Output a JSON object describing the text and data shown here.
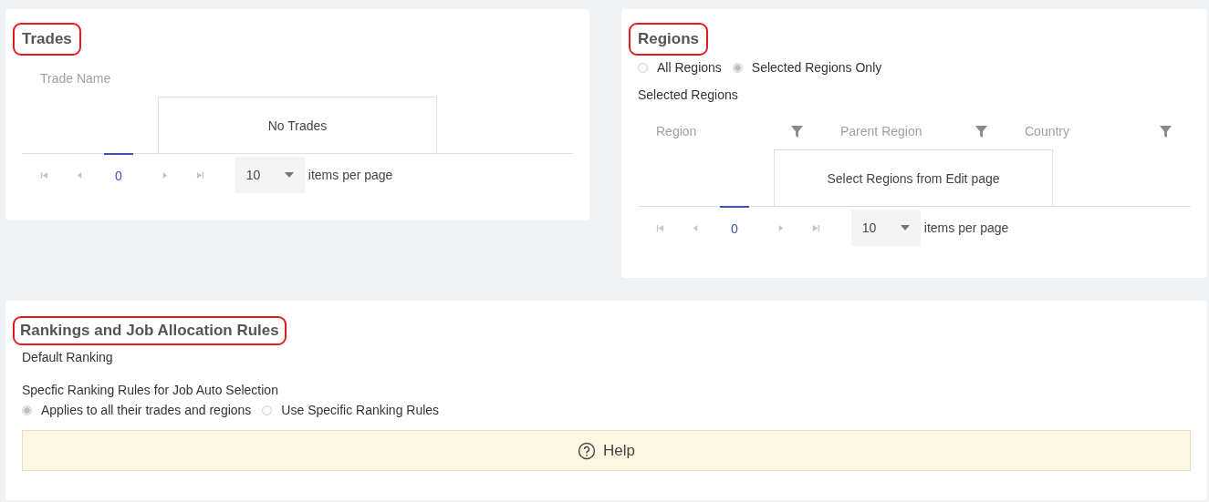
{
  "trades": {
    "title": "Trades",
    "highlighted": true,
    "columns": [
      {
        "label": "Trade Name",
        "filter": false
      }
    ],
    "empty_text": "No Trades",
    "pager": {
      "pages": [
        {
          "label": "0",
          "selected": true
        }
      ],
      "page_size": "10",
      "page_size_label": "items per page"
    }
  },
  "regions": {
    "title": "Regions",
    "highlighted": true,
    "options": [
      {
        "label": "All Regions",
        "selected": false
      },
      {
        "label": "Selected Regions Only",
        "selected": true
      }
    ],
    "subtitle": "Selected Regions",
    "columns": [
      {
        "label": "Region",
        "filter": true
      },
      {
        "label": "Parent Region",
        "filter": true
      },
      {
        "label": "Country",
        "filter": true
      }
    ],
    "empty_text": "Select Regions from Edit page",
    "pager": {
      "pages": [
        {
          "label": "0",
          "selected": true
        }
      ],
      "page_size": "10",
      "page_size_label": "items per page"
    }
  },
  "rankings": {
    "title": "Rankings and Job Allocation Rules",
    "highlighted": true,
    "default_label": "Default Ranking",
    "rules_label": "Specfic Ranking Rules for Job Auto Selection",
    "options": [
      {
        "label": "Applies to all their trades and regions",
        "selected": true
      },
      {
        "label": "Use Specific Ranking Rules",
        "selected": false
      }
    ],
    "help_button": "Help"
  }
}
